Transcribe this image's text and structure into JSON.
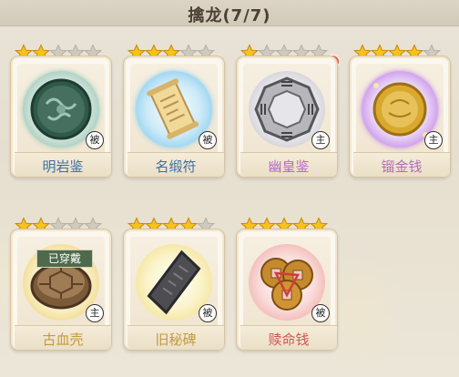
{
  "header": {
    "title": "擒龙(7/7)"
  },
  "star_max": 5,
  "items": [
    {
      "name": "明岩鉴",
      "stars": 2,
      "tag": "被",
      "name_color": "#3f6f9f",
      "glow": "#9fc9b8"
    },
    {
      "name": "名缎符",
      "stars": 3,
      "tag": "被",
      "name_color": "#3f6f9f",
      "glow": "#8fd0ee"
    },
    {
      "name": "幽皇鉴",
      "stars": 1,
      "tag": "主",
      "name_color": "#b36bbf",
      "glow": "#cfcfd4",
      "alert": true
    },
    {
      "name": "镏金钱",
      "stars": 4,
      "tag": "主",
      "name_color": "#b36bbf",
      "glow": "#c48be8"
    },
    {
      "name": "古血壳",
      "stars": 2,
      "tag": "主",
      "name_color": "#c59a3a",
      "glow": "#f0d98a",
      "badge": "已穿戴"
    },
    {
      "name": "旧秘碑",
      "stars": 4,
      "tag": "被",
      "name_color": "#c59a3a",
      "glow": "#f3e39a"
    },
    {
      "name": "赎命钱",
      "stars": 5,
      "tag": "被",
      "name_color": "#d25454",
      "glow": "#f2b4b0"
    }
  ]
}
